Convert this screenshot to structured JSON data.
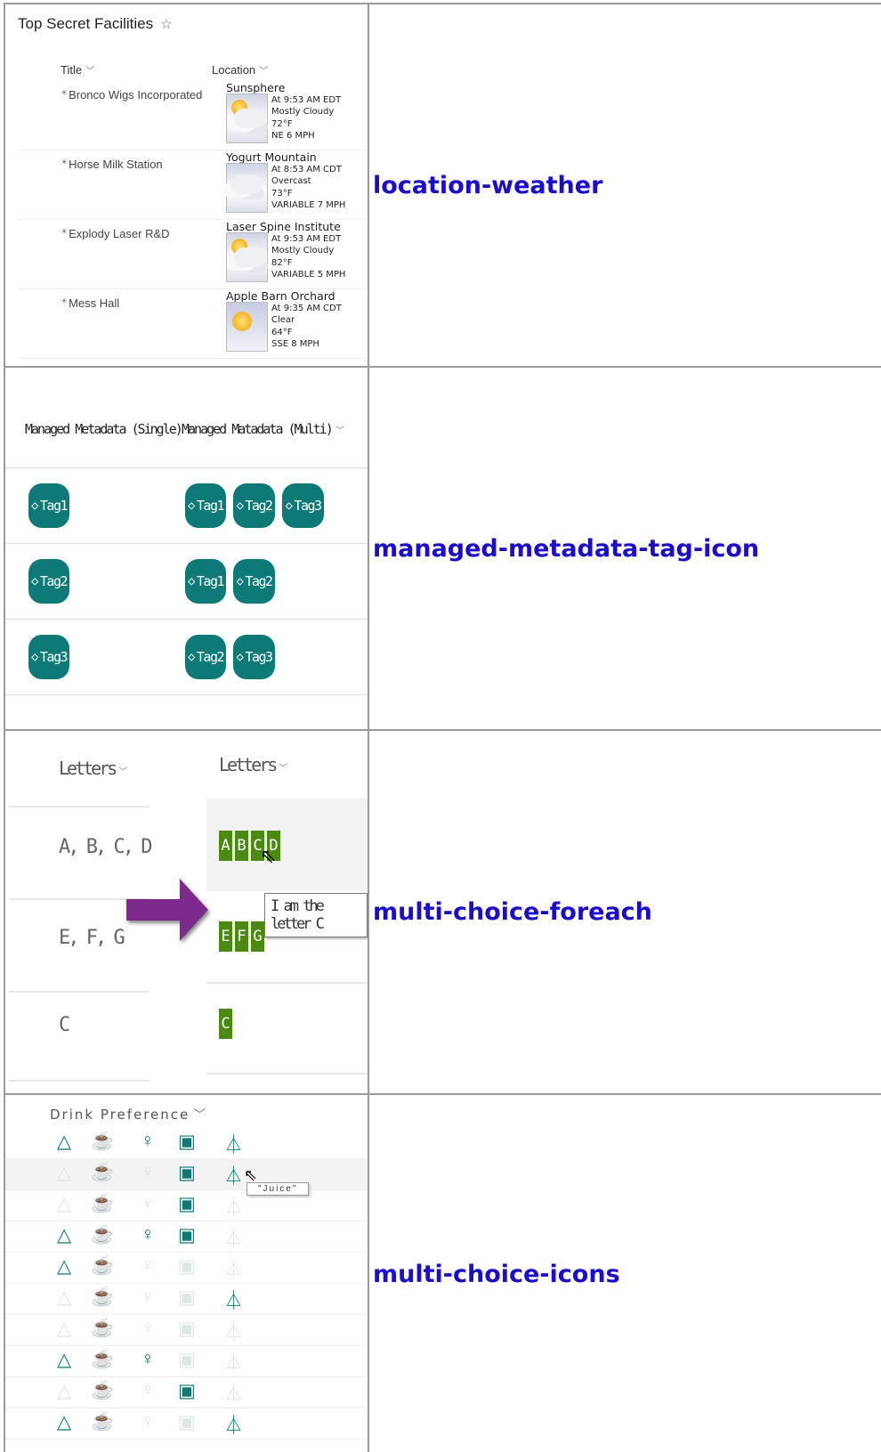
{
  "weather": {
    "list_title": "Top Secret Facilities",
    "col_title": "Title",
    "col_location": "Location",
    "rows": [
      {
        "title": "Bronco Wigs Incorporated",
        "location": "Sunsphere",
        "time": "At 9:53 AM EDT",
        "condition": "Mostly Cloudy",
        "temp": "72°F",
        "wind": "NE 6 MPH",
        "icon": "partly-cloudy-icon"
      },
      {
        "title": "Horse Milk Station",
        "location": "Yogurt Mountain",
        "time": "At 8:53 AM CDT",
        "condition": "Overcast",
        "temp": "73°F",
        "wind": "VARIABLE 7 MPH",
        "icon": "cloudy-icon"
      },
      {
        "title": "Explody Laser R&D",
        "location": "Laser Spine Institute",
        "time": "At 9:53 AM EDT",
        "condition": "Mostly Cloudy",
        "temp": "82°F",
        "wind": "VARIABLE 5 MPH",
        "icon": "partly-cloudy-icon"
      },
      {
        "title": "Mess Hall",
        "location": "Apple Barn Orchard",
        "time": "At 9:35 AM CDT",
        "condition": "Clear",
        "temp": "64°F",
        "wind": "SSE 8 MPH",
        "icon": "sunny-icon"
      }
    ]
  },
  "links": {
    "r1": "location-weather",
    "r2": "managed-metadata-tag-icon",
    "r3": "multi-choice-foreach",
    "r4": "multi-choice-icons"
  },
  "metadata": {
    "col_single": "Managed Metadata (Single)",
    "col_multi": "Managed Matadata (Multi)",
    "rows": [
      {
        "single": "Tag1",
        "multi": [
          "Tag1",
          "Tag2",
          "Tag3"
        ]
      },
      {
        "single": "Tag2",
        "multi": [
          "Tag1",
          "Tag2"
        ]
      },
      {
        "single": "Tag3",
        "multi": [
          "Tag2",
          "Tag3"
        ]
      }
    ],
    "tag_color": "#0e7a78"
  },
  "letters": {
    "col_left": "Letters",
    "col_right": "Letters",
    "rows": [
      {
        "text": "A, B, C, D",
        "boxes": [
          "A",
          "B",
          "C",
          "D"
        ]
      },
      {
        "text": "E, F, G",
        "boxes": [
          "E",
          "F",
          "G"
        ]
      },
      {
        "text": "C",
        "boxes": [
          "C"
        ]
      }
    ],
    "tooltip": "I am the letter C",
    "box_color": "#4a8a12",
    "arrow_color": "#7b2a8c"
  },
  "drinks": {
    "header": "Drink Preference",
    "tooltip": "\"Juice\"",
    "icons": [
      "water-icon",
      "coffee-icon",
      "wine-icon",
      "beer-icon",
      "juice-icon"
    ],
    "rows": [
      [
        true,
        true,
        true,
        true,
        true
      ],
      [
        false,
        false,
        false,
        true,
        true
      ],
      [
        false,
        true,
        false,
        true,
        false
      ],
      [
        true,
        false,
        true,
        true,
        false
      ],
      [
        true,
        false,
        false,
        false,
        false
      ],
      [
        false,
        false,
        false,
        false,
        true
      ],
      [
        false,
        false,
        false,
        false,
        false
      ],
      [
        true,
        true,
        true,
        false,
        false
      ],
      [
        false,
        true,
        false,
        true,
        false
      ],
      [
        true,
        false,
        false,
        false,
        true
      ]
    ],
    "on_color": "#0e7a78"
  }
}
